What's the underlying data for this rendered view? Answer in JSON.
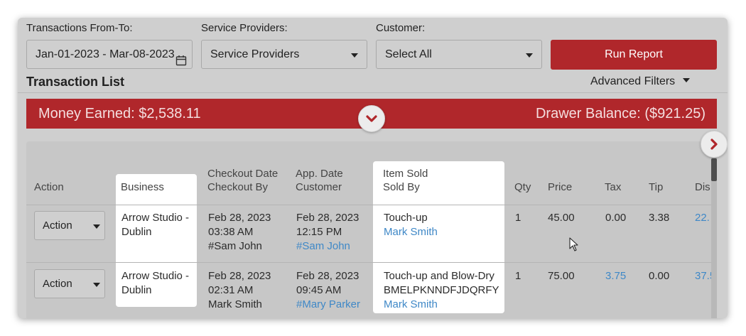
{
  "filters": {
    "date_label": "Transactions From-To:",
    "date_value": "Jan-01-2023 - Mar-08-2023",
    "providers_label": "Service Providers:",
    "providers_value": "Service Providers",
    "customer_label": "Customer:",
    "customer_value": "Select All",
    "run_label": "Run Report"
  },
  "list": {
    "title": "Transaction List",
    "advanced_filters": "Advanced Filters"
  },
  "banner": {
    "money_earned": "Money Earned:  $2,538.11",
    "drawer_balance": "Drawer Balance:  ($921.25)"
  },
  "columns": {
    "action": "Action",
    "business": "Business",
    "checkout_date": "Checkout Date",
    "checkout_by": "Checkout By",
    "app_date": "App. Date",
    "customer": "Customer",
    "item_sold": "Item Sold",
    "sold_by": "Sold By",
    "qty": "Qty",
    "price": "Price",
    "tax": "Tax",
    "tip": "Tip",
    "discount": "Dis"
  },
  "rows": [
    {
      "action": "Action",
      "business_1": "Arrow Studio -",
      "business_2": "Dublin",
      "checkout_date": "Feb 28, 2023",
      "checkout_time": "03:38 AM",
      "checkout_by": "#Sam John",
      "app_date": "Feb 28, 2023",
      "app_time": "12:15 PM",
      "customer": "#Sam John",
      "item": "Touch-up",
      "item_code": "",
      "sold_by": "Mark Smith",
      "qty": "1",
      "price": "45.00",
      "tax": "0.00",
      "tip": "3.38",
      "discount": "22."
    },
    {
      "action": "Action",
      "business_1": "Arrow Studio -",
      "business_2": "Dublin",
      "checkout_date": "Feb 28, 2023",
      "checkout_time": "02:31 AM",
      "checkout_by": "Mark Smith",
      "app_date": "Feb 28, 2023",
      "app_time": "09:45 AM",
      "customer": "#Mary Parker",
      "item": "Touch-up and Blow-Dry",
      "item_code": "BMELPKNNDFJDQRFY",
      "sold_by": "Mark Smith",
      "qty": "1",
      "price": "75.00",
      "tax": "3.75",
      "tip": "0.00",
      "discount": "37.5"
    }
  ],
  "colors": {
    "accent": "#b0272b",
    "link": "#3f88c7"
  }
}
